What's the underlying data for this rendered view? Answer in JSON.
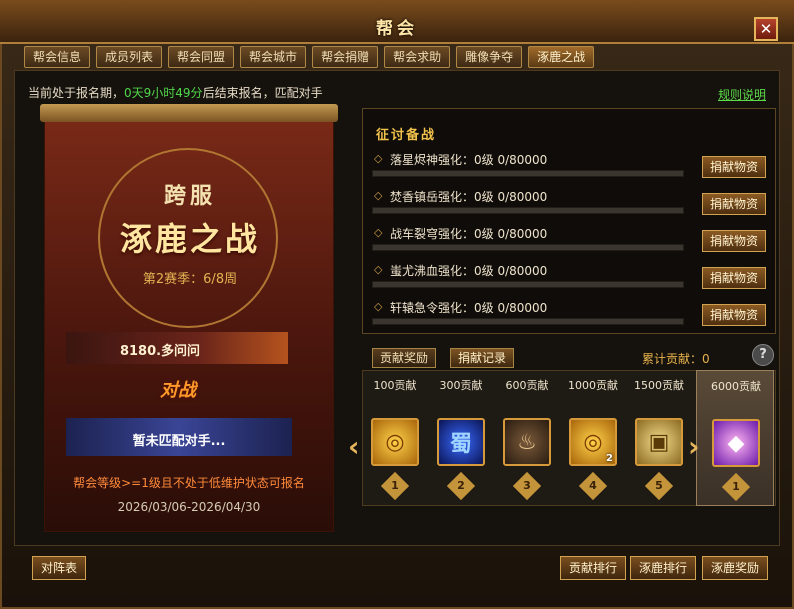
{
  "window": {
    "title": "帮会",
    "close_label": "✕"
  },
  "tabs": [
    "帮会信息",
    "成员列表",
    "帮会同盟",
    "帮会城市",
    "帮会捐赠",
    "帮会求助",
    "雕像争夺",
    "涿鹿之战"
  ],
  "active_tab": 7,
  "notice": {
    "prefix": "当前处于报名期，",
    "countdown": "0天9小时49分",
    "suffix": "后结束报名，匹配对手"
  },
  "rules_link": "规则说明",
  "banner": {
    "subtitle": "跨服",
    "title": "涿鹿之战",
    "season": "第2赛季：6/8周",
    "opponent": "8180.多问问",
    "vs": "对战",
    "unmatched": "暂未匹配对手...",
    "requirement": "帮会等级>=1级且不处于低维护状态可报名",
    "dates": "2026/03/06-2026/04/30"
  },
  "prep": {
    "title": "征讨备战",
    "donate_label": "捐献物资",
    "rows": [
      {
        "label": "落星烬神强化：0级  0/80000",
        "progress": 0
      },
      {
        "label": "焚香镇岳强化：0级  0/80000",
        "progress": 0
      },
      {
        "label": "战车裂穹强化：0级  0/80000",
        "progress": 0
      },
      {
        "label": "蚩尤沸血强化：0级  0/80000",
        "progress": 0
      },
      {
        "label": "轩辕急令强化：0级  0/80000",
        "progress": 0
      }
    ]
  },
  "rewards": {
    "tabs": [
      "贡献奖励",
      "捐献记录"
    ],
    "active_tab": 1,
    "accumulated": "累计贡献：0",
    "help": "?",
    "tiers": [
      {
        "label": "100贡献",
        "icon": "gold-coil-icon",
        "badge": "1",
        "count": ""
      },
      {
        "label": "300贡献",
        "icon": "blue-rune-icon",
        "badge": "2",
        "count": ""
      },
      {
        "label": "600贡献",
        "icon": "teapot-icon",
        "badge": "3",
        "count": ""
      },
      {
        "label": "1000贡献",
        "icon": "gold-coil-icon",
        "badge": "4",
        "count": "2"
      },
      {
        "label": "1500贡献",
        "icon": "treasure-chest-icon",
        "badge": "5",
        "count": ""
      },
      {
        "label": "6000贡献",
        "icon": "pink-crystal-icon",
        "badge": "1",
        "count": ""
      }
    ],
    "highlight_index": 5
  },
  "bottom": {
    "lineup": "对阵表",
    "contribution_rank": "贡献排行",
    "zhuolu_rank": "涿鹿排行",
    "zhuolu_reward": "涿鹿奖励"
  },
  "colors": {
    "accent": "#e5b55c",
    "countdown": "#4fd84a",
    "link": "#5ddc4a",
    "warning": "#ff8a3a"
  }
}
